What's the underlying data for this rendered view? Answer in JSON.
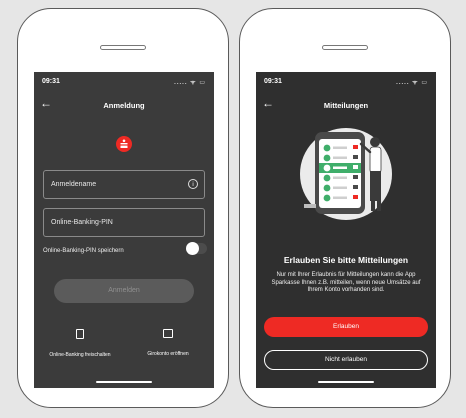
{
  "left_screen": {
    "status": {
      "time": "09:31",
      "icons_text": "..... ᯤ ▭"
    },
    "nav": {
      "back_glyph": "←",
      "title": "Anmeldung"
    },
    "logo_glyph": "ᚼ",
    "username": {
      "placeholder": "Anmeldename",
      "info_glyph": "i"
    },
    "pin": {
      "placeholder": "Online-Banking-PIN"
    },
    "save_pin": {
      "label": "Online-Banking-PIN speichern",
      "enabled": false
    },
    "login_button": "Anmelden",
    "actions": [
      {
        "label": "Online-Banking freischalten",
        "icon": "phone-icon"
      },
      {
        "label": "Girokonto eröffnen",
        "icon": "card-icon"
      }
    ]
  },
  "right_screen": {
    "status": {
      "time": "09:31",
      "icons_text": "..... ᯤ ▭"
    },
    "nav": {
      "back_glyph": "←",
      "title": "Mitteilungen"
    },
    "title": "Erlauben Sie bitte Mitteilungen",
    "body": "Nur mit Ihrer Erlaubnis für Mitteilungen kann die App Sparkasse Ihnen z.B. mitteilen, wenn neue Umsätze auf Ihrem Konto vorhanden sind.",
    "allow_button": "Erlauben",
    "deny_button": "Nicht erlauben"
  },
  "colors": {
    "brand_red": "#ee2a24",
    "screen_bg": "#3b3b3b",
    "accent_green": "#3fae6a"
  }
}
